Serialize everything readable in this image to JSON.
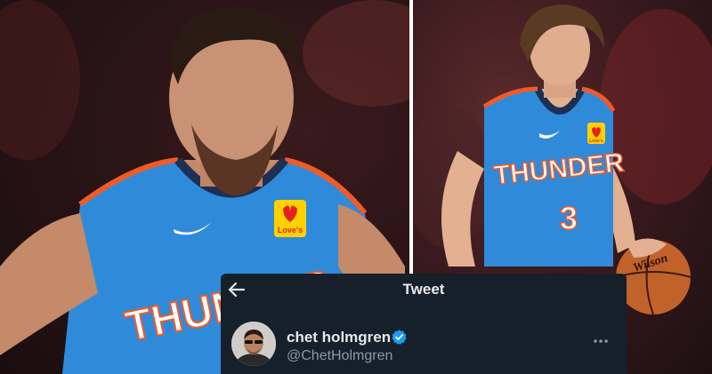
{
  "photos": {
    "left": {
      "jersey_text": "THUNDER",
      "patch_text": "Love's"
    },
    "right": {
      "jersey_text": "THUNDER",
      "jersey_number": "3",
      "patch_text": "Love's",
      "ball_text": "Wilson"
    }
  },
  "tweet": {
    "header_title": "Tweet",
    "display_name": "chet holmgren",
    "handle": "@ChetHolmgren",
    "verified": true
  },
  "icons": {
    "back": "arrow-left-icon",
    "verified": "verified-badge-icon",
    "more": "more-horizontal-icon"
  },
  "colors": {
    "card_bg": "#15202b",
    "text_primary": "#e7e9ea",
    "text_secondary": "#8b98a5",
    "verified_blue": "#1d9bf0",
    "jersey_blue": "#2f8bd9",
    "jersey_orange": "#f05a28"
  }
}
